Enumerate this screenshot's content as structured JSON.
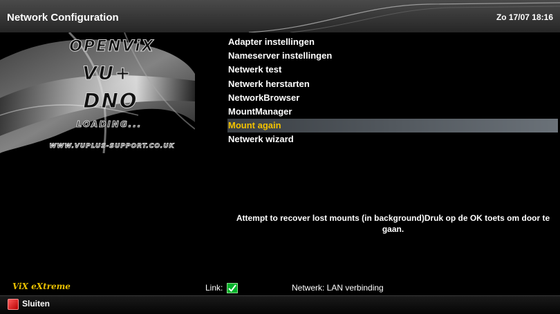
{
  "header": {
    "title": "Network Configuration",
    "datetime": "Zo 17/07  18:16"
  },
  "logo": {
    "line1": "OPENViX",
    "line2": "VU+",
    "line3": "DNO",
    "line4": "LOADING...",
    "line5": "WWW.VUPLUS-SUPPORT.CO.UK"
  },
  "menu": {
    "selected_index": 6,
    "items": [
      {
        "label": "Adapter instellingen"
      },
      {
        "label": "Nameserver instellingen"
      },
      {
        "label": "Netwerk test"
      },
      {
        "label": "Netwerk herstarten"
      },
      {
        "label": "NetworkBrowser"
      },
      {
        "label": "MountManager"
      },
      {
        "label": "Mount again"
      },
      {
        "label": "Netwerk wizard"
      }
    ]
  },
  "description": "Attempt to recover lost mounts (in background)Druk op de OK toets om door te gaan.",
  "status": {
    "brand": "ViX eXtreme",
    "link_label": "Link:",
    "link_ok": true,
    "network": "Netwerk: LAN verbinding"
  },
  "footer": {
    "red_key_label": "Sluiten"
  },
  "colors": {
    "selected_text": "#f3c200",
    "red_key": "#d01010",
    "link_check": "#00b22a"
  }
}
